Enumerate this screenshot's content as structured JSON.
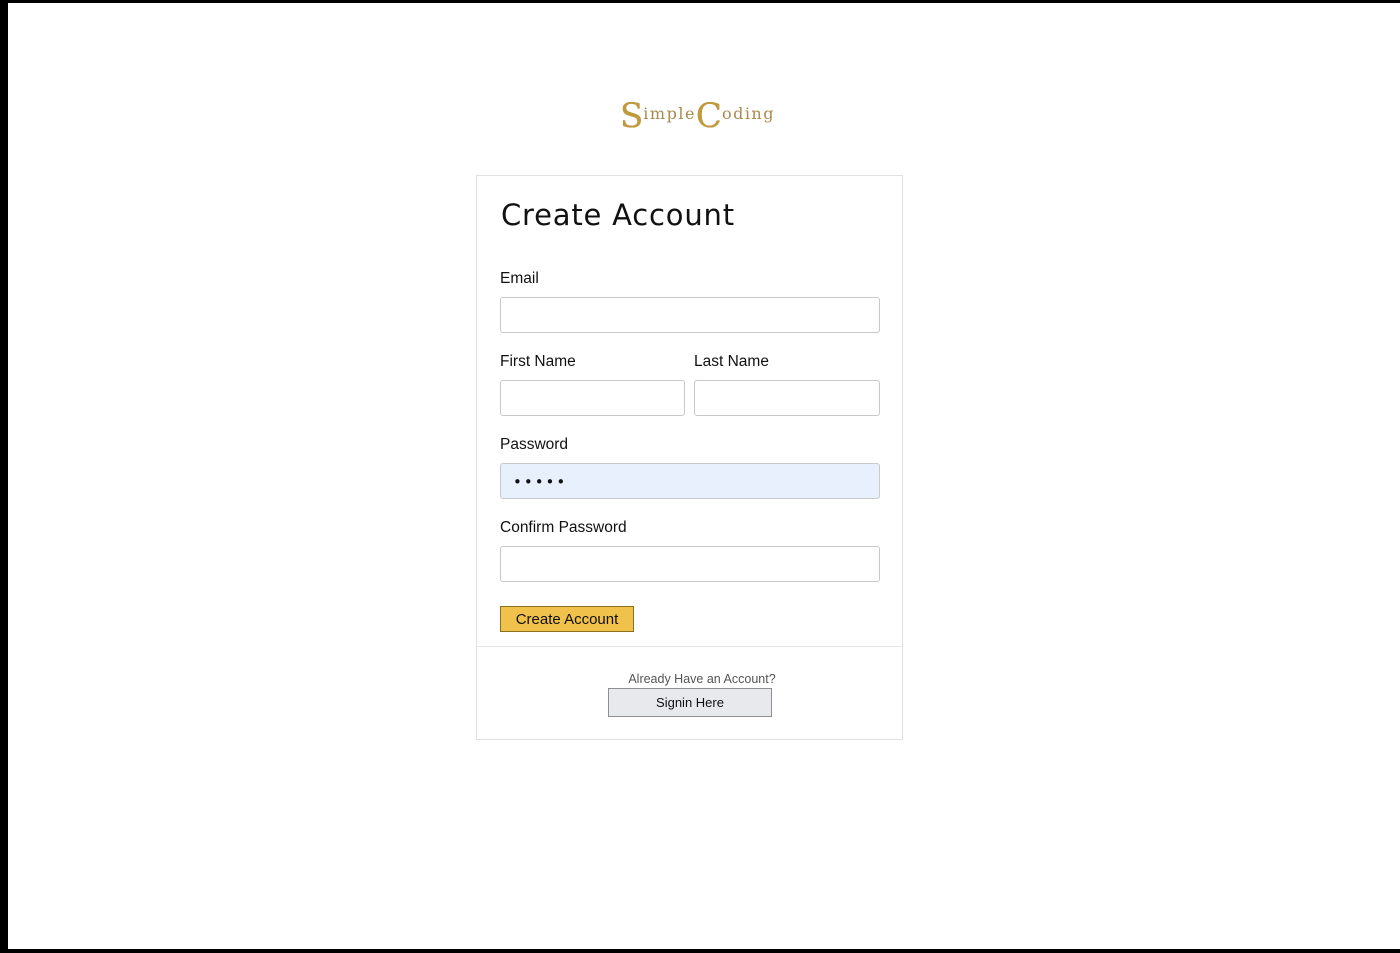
{
  "logo": {
    "letter1": "S",
    "rest1": "imple",
    "letter2": "C",
    "rest2": "oding"
  },
  "form": {
    "title": "Create Account",
    "email_label": "Email",
    "email_value": "",
    "first_name_label": "First Name",
    "first_name_value": "",
    "last_name_label": "Last Name",
    "last_name_value": "",
    "password_label": "Password",
    "password_display": "•••••",
    "confirm_password_label": "Confirm Password",
    "confirm_password_value": "",
    "submit_label": "Create Account"
  },
  "footer": {
    "prompt": "Already Have an Account?",
    "signin_label": "Signin Here"
  },
  "colors": {
    "primary_button": "#f0c14b",
    "secondary_button": "#e7e9ec",
    "autofill_background": "#e8f0fe",
    "logo_gold": "#c19a3c"
  }
}
